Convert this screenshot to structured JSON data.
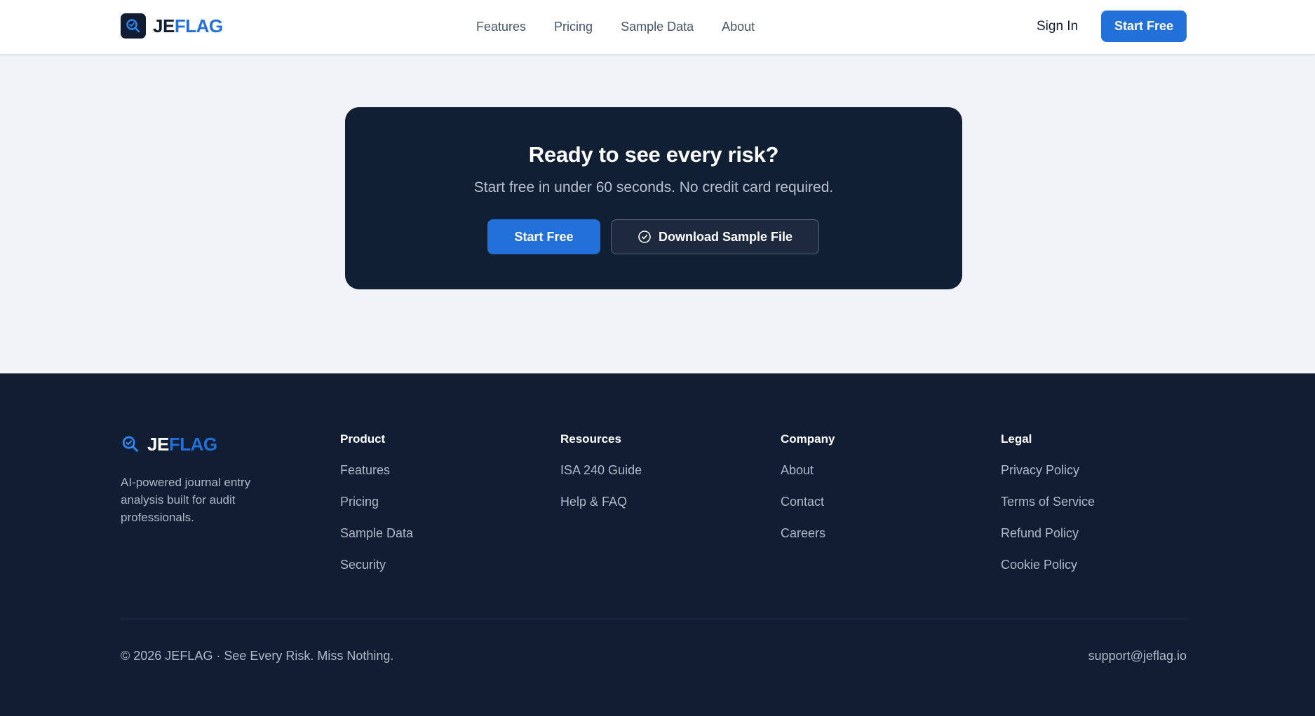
{
  "brand": {
    "name_part1": "JE",
    "name_part2": "FLAG"
  },
  "header": {
    "nav": [
      "Features",
      "Pricing",
      "Sample Data",
      "About"
    ],
    "sign_in": "Sign In",
    "start_free": "Start Free"
  },
  "cta": {
    "title": "Ready to see every risk?",
    "subtitle": "Start free in under 60 seconds. No credit card required.",
    "start_free": "Start Free",
    "download": "Download Sample File"
  },
  "footer": {
    "description": "AI-powered journal entry analysis built for audit professionals.",
    "columns": [
      {
        "title": "Product",
        "links": [
          "Features",
          "Pricing",
          "Sample Data",
          "Security"
        ]
      },
      {
        "title": "Resources",
        "links": [
          "ISA 240 Guide",
          "Help & FAQ"
        ]
      },
      {
        "title": "Company",
        "links": [
          "About",
          "Contact",
          "Careers"
        ]
      },
      {
        "title": "Legal",
        "links": [
          "Privacy Policy",
          "Terms of Service",
          "Refund Policy",
          "Cookie Policy"
        ]
      }
    ],
    "copyright": "© 2026 JEFLAG · See Every Risk. Miss Nothing.",
    "support_email": "support@jeflag.io"
  },
  "colors": {
    "accent": "#2270d9",
    "dark": "#111d33",
    "background": "#f1f3f8"
  },
  "icons": {
    "logo": "magnifier-check-icon",
    "download": "check-circle-icon"
  }
}
